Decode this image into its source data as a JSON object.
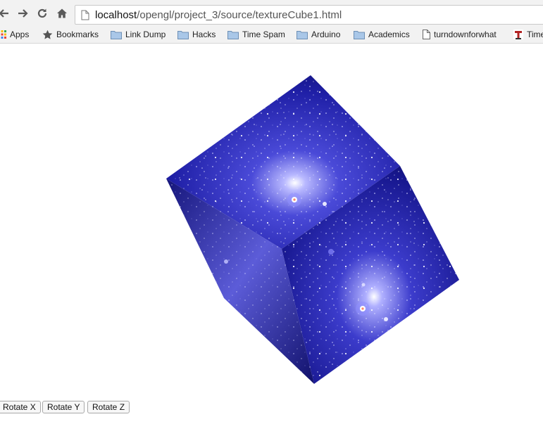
{
  "browser": {
    "address_bar": {
      "host": "localhost",
      "path": "/opengl/project_3/source/textureCube1.html"
    },
    "icons": [
      "back-arrow-icon",
      "forward-arrow-icon",
      "reload-icon",
      "home-icon",
      "page-icon"
    ]
  },
  "bookmarks": [
    {
      "label": "Apps",
      "icon": "apps-grid-icon"
    },
    {
      "label": "Bookmarks",
      "icon": "star-icon"
    },
    {
      "label": "Link Dump",
      "icon": "folder-icon"
    },
    {
      "label": "Hacks",
      "icon": "folder-icon"
    },
    {
      "label": "Time Spam",
      "icon": "folder-icon"
    },
    {
      "label": "Arduino",
      "icon": "folder-icon"
    },
    {
      "label": "Academics",
      "icon": "folder-icon"
    },
    {
      "label": "turndownforwhat",
      "icon": "page-icon"
    },
    {
      "label": "Time",
      "icon": "site-favicon-icon"
    }
  ],
  "canvas": {
    "content": "textured-cube-icon",
    "texture_color": "#1a1a9c",
    "highlight_color": "#c8c8ff"
  },
  "controls": {
    "rotate_x": "Rotate X",
    "rotate_y": "Rotate Y",
    "rotate_z": "Rotate Z"
  }
}
